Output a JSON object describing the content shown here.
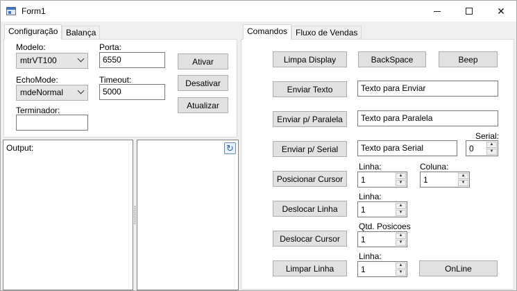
{
  "window": {
    "title": "Form1"
  },
  "left_tabs": [
    "Configuração",
    "Balança"
  ],
  "config": {
    "modelo_label": "Modelo:",
    "modelo_value": "mtrVT100",
    "porta_label": "Porta:",
    "porta_value": "6550",
    "echomode_label": "EchoMode:",
    "echomode_value": "mdeNormal",
    "timeout_label": "Timeout:",
    "timeout_value": "5000",
    "terminador_label": "Terminador:",
    "terminador_value": "",
    "ativar": "Ativar",
    "desativar": "Desativar",
    "atualizar": "Atualizar"
  },
  "output": {
    "label": "Output:"
  },
  "right_tabs": [
    "Comandos",
    "Fluxo de Vendas"
  ],
  "commands": {
    "limpa_display": "Limpa Display",
    "backspace": "BackSpace",
    "beep": "Beep",
    "enviar_texto": "Enviar Texto",
    "enviar_texto_value": "Texto para Enviar",
    "enviar_paralela": "Enviar p/ Paralela",
    "enviar_paralela_value": "Texto para Paralela",
    "serial_label": "Serial:",
    "enviar_serial": "Enviar p/ Serial",
    "enviar_serial_value": "Texto para Serial",
    "serial_value": "0",
    "posicionar_cursor": "Posicionar Cursor",
    "linha_label": "Linha:",
    "coluna_label": "Coluna:",
    "pos_linha_value": "1",
    "pos_coluna_value": "1",
    "deslocar_linha": "Deslocar Linha",
    "desloc_linha_value": "1",
    "deslocar_cursor": "Deslocar Cursor",
    "qtd_posicoes_label": "Qtd. Posicoes",
    "qtd_posicoes_value": "1",
    "limpar_linha": "Limpar Linha",
    "limpar_linha_value": "1",
    "online": "OnLine"
  }
}
